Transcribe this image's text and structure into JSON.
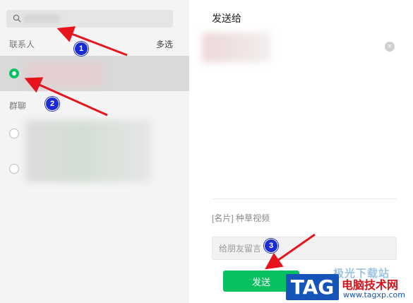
{
  "left_panel": {
    "search_icon": "search-icon",
    "contacts_label": "联系人",
    "multi_select_label": "多选",
    "groups_label": "群聊"
  },
  "right_panel": {
    "title": "发送给",
    "close_icon": "close-icon",
    "close_glyph": "×",
    "card_label": "[名片] 种草视频",
    "message_placeholder": "给朋友留言",
    "send_label": "发送"
  },
  "annotations": {
    "badges": [
      "1",
      "2",
      "3"
    ],
    "arrow_color": "#e8141d",
    "badge_color": "#1c2ad6"
  },
  "watermark": {
    "faded_text": "极光下载站",
    "tag": "TAG",
    "site_name": "电脑技术网",
    "url": "www.tagxp.com"
  },
  "colors": {
    "accent": "#07c160",
    "sidebar_bg": "#f4f4f4",
    "selected_row_bg": "#d9d9d9"
  }
}
